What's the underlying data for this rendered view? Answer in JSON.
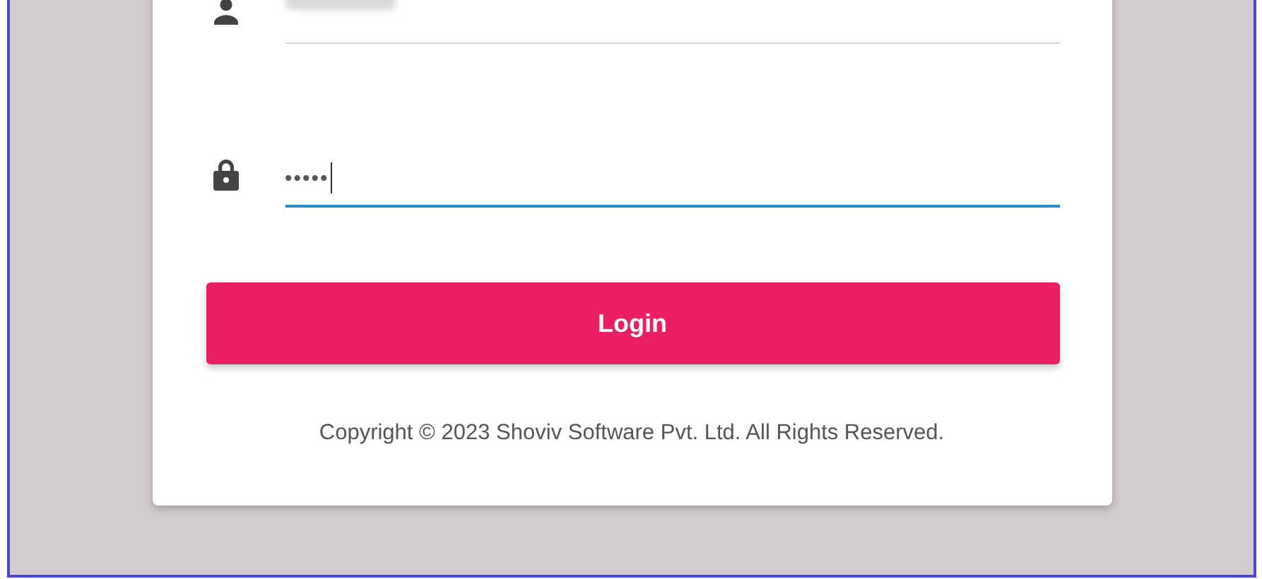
{
  "login_form": {
    "fields": [
      {
        "kind": "username",
        "focused": false
      },
      {
        "kind": "password",
        "value": "•••••",
        "focused": true
      }
    ],
    "button": "Login",
    "copyright": "Copyright © 2023 Shoviv Software Pvt. Ltd. All Rights Reserved."
  }
}
